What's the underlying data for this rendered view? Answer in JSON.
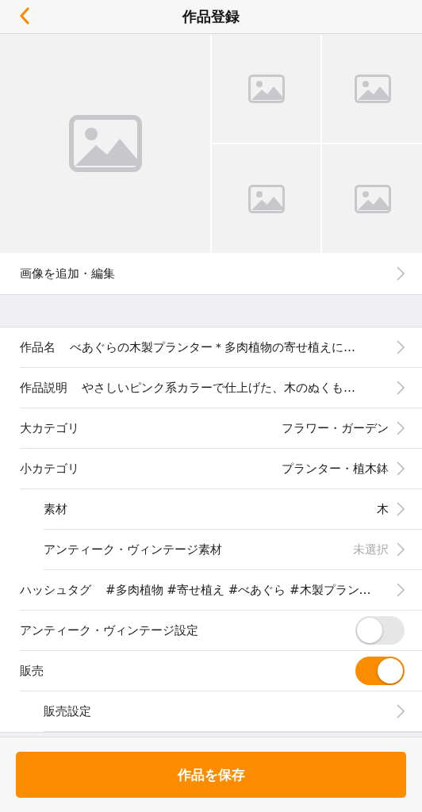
{
  "header": {
    "title": "作品登録"
  },
  "photos": {
    "slots": [
      {
        "kind": "main"
      },
      {
        "kind": "sub"
      },
      {
        "kind": "sub"
      },
      {
        "kind": "sub"
      },
      {
        "kind": "sub"
      }
    ],
    "edit_label": "画像を追加・編集"
  },
  "rows": [
    {
      "kind": "field",
      "label": "作品名",
      "value": "べあぐらの木製プランター＊多肉植物の寄せ植えに…"
    },
    {
      "kind": "field",
      "label": "作品説明",
      "value": "やさしいピンク系カラーで仕上げた、木のぬくも…"
    },
    {
      "kind": "picker",
      "label": "大カテゴリ",
      "value": "フラワー・ガーデン"
    },
    {
      "kind": "picker",
      "label": "小カテゴリ",
      "value": "プランター・植木鉢",
      "children": [
        {
          "kind": "picker",
          "label": "素材",
          "value": "木"
        },
        {
          "kind": "picker",
          "label": "アンティーク・ヴィンテージ素材",
          "value": "未選択",
          "muted": true
        }
      ]
    },
    {
      "kind": "field",
      "label": "ハッシュタグ",
      "value": "#多肉植物 #寄せ植え #べあぐら #木製プラン…"
    },
    {
      "kind": "toggle",
      "label": "アンティーク・ヴィンテージ設定",
      "on": false
    },
    {
      "kind": "toggle",
      "label": "販売",
      "on": true,
      "children": [
        {
          "kind": "picker",
          "label": "販売設定"
        }
      ]
    }
  ],
  "save_button": "作品を保存"
}
